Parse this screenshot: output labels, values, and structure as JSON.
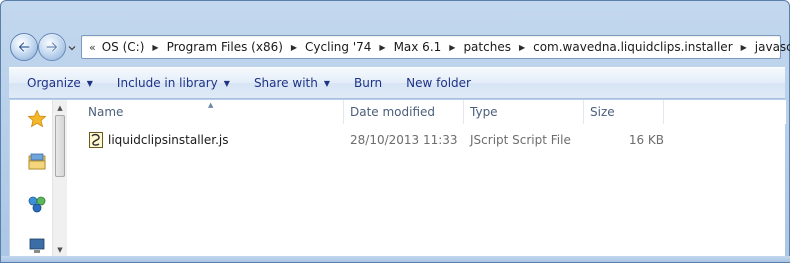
{
  "address": {
    "overflow_chevron": "«",
    "breadcrumbs": [
      {
        "label": "OS (C:)"
      },
      {
        "label": "Program Files (x86)"
      },
      {
        "label": "Cycling '74"
      },
      {
        "label": "Max 6.1"
      },
      {
        "label": "patches"
      },
      {
        "label": "com.wavedna.liquidclips.installer"
      },
      {
        "label": "javascript"
      }
    ]
  },
  "toolbar": {
    "organize": "Organize",
    "include_in_library": "Include in library",
    "share_with": "Share with",
    "burn": "Burn",
    "new_folder": "New folder"
  },
  "columns": {
    "name": "Name",
    "date_modified": "Date modified",
    "type": "Type",
    "size": "Size"
  },
  "files": [
    {
      "name": "liquidclipsinstaller.js",
      "date_modified": "28/10/2013 11:33 ...",
      "type": "JScript Script File",
      "size": "16 KB",
      "icon": "jscript-file-icon"
    }
  ],
  "nav_pane": {
    "icons": [
      "favorites-star-icon",
      "libraries-icon",
      "homegroup-icon",
      "computer-icon"
    ]
  },
  "colors": {
    "toolbar_text": "#1e3287",
    "header_text": "#4c607a",
    "detail_text": "#6d6d6d"
  }
}
